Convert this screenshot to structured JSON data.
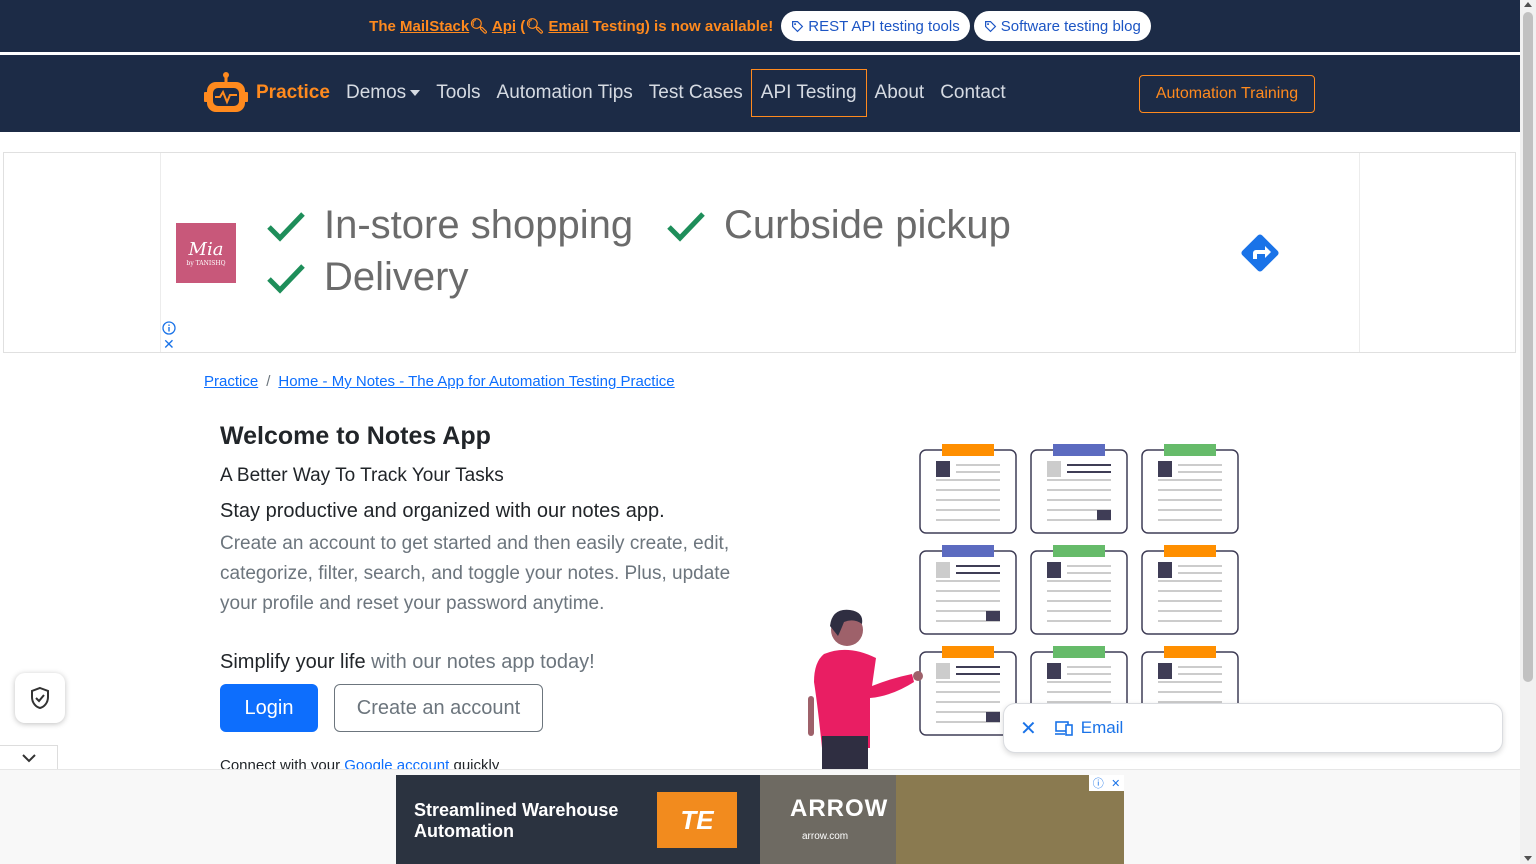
{
  "announcement": {
    "prefix": "The ",
    "mailstack": "MailStack",
    "api": "Api",
    "paren_open": " (",
    "email_testing": "Email",
    "suffix": " Testing) is now available!",
    "pill_1": "REST API testing tools",
    "pill_2": "Software testing blog"
  },
  "navbar": {
    "brand": "Practice",
    "links": [
      "Demos",
      "Tools",
      "Automation Tips",
      "Test Cases",
      "API Testing",
      "About",
      "Contact"
    ],
    "active_link": "API Testing",
    "training_button": "Automation Training"
  },
  "ad_banner": {
    "logo_text": "Mia",
    "logo_small": "by TANISHQ",
    "items": [
      "In-store shopping",
      "Curbside pickup",
      "Delivery"
    ]
  },
  "breadcrumb": {
    "root": "Practice",
    "separator": "/",
    "current": "Home - My Notes - The App for Automation Testing Practice"
  },
  "main": {
    "title": "Welcome to Notes App",
    "subtitle": "A Better Way To Track Your Tasks",
    "lead": "Stay productive and organized with our notes app.",
    "description": "Create an account to get started and then easily create, edit, categorize, filter, search, and toggle your notes. Plus, update your profile and reset your password anytime.",
    "simplify_dark": "Simplify your life",
    "simplify_rest": " with our notes app today!",
    "login_button": "Login",
    "create_button": "Create an account",
    "connect_prefix": "Connect with your ",
    "connect_link": "Google account",
    "connect_suffix": " quickly"
  },
  "email_popup": {
    "label": "Email"
  },
  "bottom_ad": {
    "headline_1": "Streamlined Warehouse",
    "headline_2": "Automation",
    "te_logo": "TE",
    "arrow_logo": "ARROW",
    "arrow_url": "arrow.com"
  },
  "colors": {
    "navy": "#1c2b46",
    "orange": "#ff8a1e",
    "primary": "#0d6efd"
  }
}
